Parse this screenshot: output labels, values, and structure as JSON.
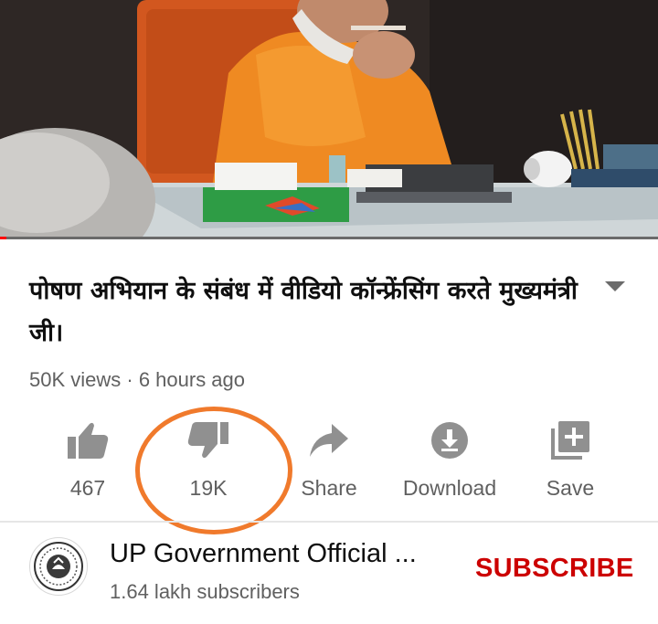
{
  "video": {
    "progress_fraction": 0.01
  },
  "title": "पोषण अभियान के संबंध में वीडियो कॉन्फ्रेंसिंग करते मुख्यमंत्री जी।",
  "meta": "50K views · 6 hours ago",
  "actions": [
    {
      "name": "like",
      "label": "467",
      "icon": "thumb-up-icon"
    },
    {
      "name": "dislike",
      "label": "19K",
      "icon": "thumb-down-icon"
    },
    {
      "name": "share",
      "label": "Share",
      "icon": "share-icon"
    },
    {
      "name": "download",
      "label": "Download",
      "icon": "download-icon"
    },
    {
      "name": "save",
      "label": "Save",
      "icon": "playlist-add-icon"
    }
  ],
  "annotation_color": "#f07a2c",
  "channel": {
    "name": "UP Government Official ...",
    "subscribers": "1.64 lakh subscribers",
    "subscribe_label": "SUBSCRIBE",
    "subscribe_color": "#cc0000"
  }
}
